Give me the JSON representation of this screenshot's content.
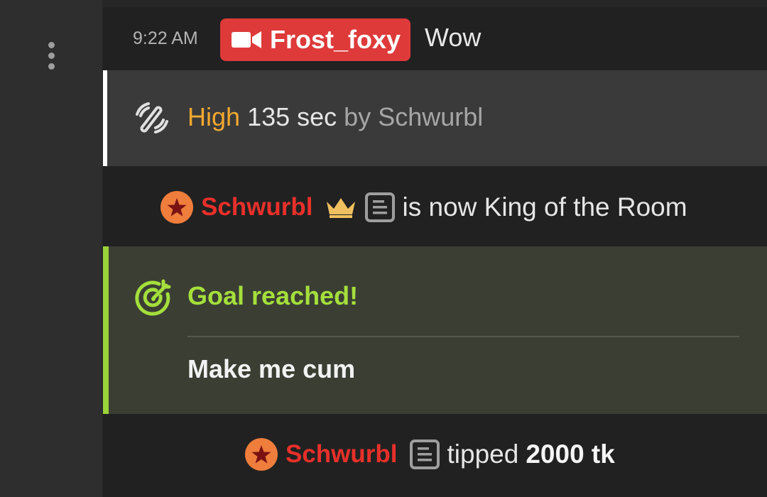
{
  "chat": {
    "message": {
      "time": "9:22 AM",
      "username": "Frost_foxy",
      "text": "Wow",
      "badge_color": "#de3a3a",
      "badge_icon": "video-camera-icon"
    },
    "vibe_event": {
      "level": "High",
      "duration": "135 sec",
      "by_prefix": "by",
      "by_user": "Schwurbl",
      "icon": "vibration-icon",
      "level_color": "#f2a830"
    },
    "king_event": {
      "username": "Schwurbl",
      "text": "is now King of the Room",
      "icons": [
        "star-badge-icon",
        "crown-icon",
        "note-icon"
      ],
      "name_color": "#e8302a"
    },
    "goal_event": {
      "title": "Goal reached!",
      "description": "Make me cum",
      "icon": "target-icon",
      "accent_color": "#9ad33a"
    },
    "tip_event": {
      "username": "Schwurbl",
      "text": "tipped",
      "amount": "2000 tk",
      "icons": [
        "star-badge-icon",
        "note-icon"
      ]
    }
  },
  "sidebar": {
    "menu_icon": "more-vertical-icon"
  }
}
